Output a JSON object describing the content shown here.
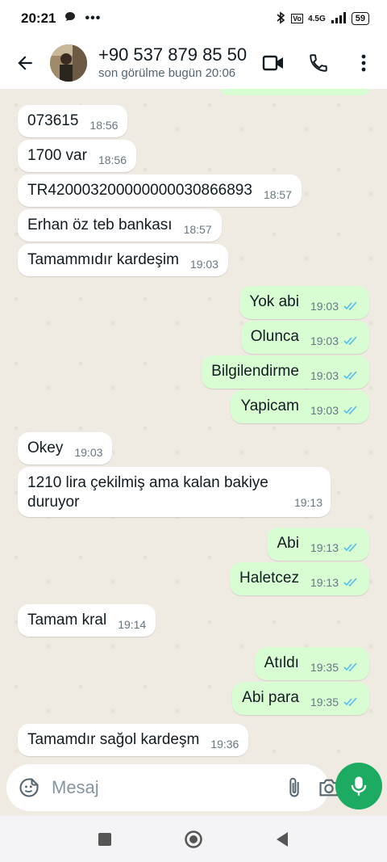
{
  "status_bar": {
    "time": "20:21",
    "network": "4.5G",
    "battery": "59"
  },
  "header": {
    "contact_name": "+90 537 879 85 50",
    "last_seen": "son görülme bugün 20:06"
  },
  "messages": [
    {
      "dir": "in",
      "text": "073615",
      "time": "18:56"
    },
    {
      "dir": "in",
      "text": "1700 var",
      "time": "18:56"
    },
    {
      "dir": "in",
      "text": "TR420003200000000030866893",
      "time": "18:57"
    },
    {
      "dir": "in",
      "text": "Erhan öz teb bankası",
      "time": "18:57"
    },
    {
      "dir": "in",
      "text": "Tamammıdır kardeşim",
      "time": "19:03"
    },
    {
      "dir": "out",
      "text": "Yok abi",
      "time": "19:03"
    },
    {
      "dir": "out",
      "text": "Olunca",
      "time": "19:03"
    },
    {
      "dir": "out",
      "text": "Bilgilendirme",
      "time": "19:03"
    },
    {
      "dir": "out",
      "text": "Yapicam",
      "time": "19:03"
    },
    {
      "dir": "in",
      "text": "Okey",
      "time": "19:03"
    },
    {
      "dir": "in",
      "text": "1210 lira çekilmiş ama kalan bakiye duruyor",
      "time": "19:13"
    },
    {
      "dir": "out",
      "text": "Abi",
      "time": "19:13"
    },
    {
      "dir": "out",
      "text": "Haletcez",
      "time": "19:13"
    },
    {
      "dir": "in",
      "text": "Tamam kral",
      "time": "19:14"
    },
    {
      "dir": "out",
      "text": "Atıldı",
      "time": "19:35"
    },
    {
      "dir": "out",
      "text": "Abi para",
      "time": "19:35"
    },
    {
      "dir": "in",
      "text": "Tamamdır sağol kardeşm",
      "time": "19:36"
    }
  ],
  "composer": {
    "placeholder": "Mesaj"
  },
  "icons": {
    "back": "back-arrow-icon",
    "video": "video-call-icon",
    "call": "phone-icon",
    "menu": "more-vertical-icon",
    "sticker": "sticker-icon",
    "attach": "paperclip-icon",
    "camera": "camera-icon",
    "mic": "microphone-icon"
  },
  "colors": {
    "outgoing_bubble": "#d9fdd3",
    "incoming_bubble": "#ffffff",
    "read_ticks": "#53bdeb",
    "mic_button": "#1daa61"
  }
}
